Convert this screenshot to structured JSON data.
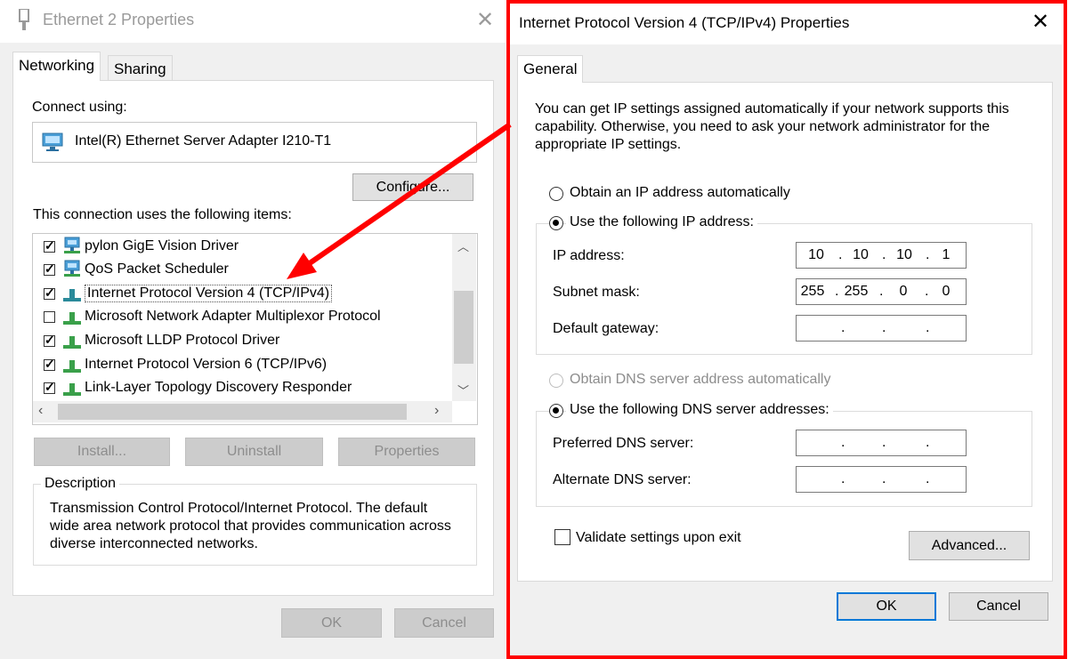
{
  "left_dialog": {
    "title": "Ethernet 2 Properties",
    "tabs": [
      "Networking",
      "Sharing"
    ],
    "connect_using_label": "Connect using:",
    "adapter_name": "Intel(R) Ethernet Server Adapter I210-T1",
    "configure_button": "Configure...",
    "items_label": "This connection uses the following items:",
    "items": [
      {
        "label": "pylon GigE Vision Driver",
        "checked": true
      },
      {
        "label": "QoS Packet Scheduler",
        "checked": true
      },
      {
        "label": "Internet Protocol Version 4 (TCP/IPv4)",
        "checked": true,
        "selected": true
      },
      {
        "label": "Microsoft Network Adapter Multiplexor Protocol",
        "checked": false
      },
      {
        "label": "Microsoft LLDP Protocol Driver",
        "checked": true
      },
      {
        "label": "Internet Protocol Version 6 (TCP/IPv6)",
        "checked": true
      },
      {
        "label": "Link-Layer Topology Discovery Responder",
        "checked": true
      }
    ],
    "install_button": "Install...",
    "uninstall_button": "Uninstall",
    "properties_button": "Properties",
    "description_label": "Description",
    "description_text": "Transmission Control Protocol/Internet Protocol. The default wide area network protocol that provides communication across diverse interconnected networks.",
    "ok_button": "OK",
    "cancel_button": "Cancel"
  },
  "right_dialog": {
    "title": "Internet Protocol Version 4 (TCP/IPv4) Properties",
    "tab": "General",
    "intro_text": "You can get IP settings assigned automatically if your network supports this capability. Otherwise, you need to ask your network administrator for the appropriate IP settings.",
    "auto_ip_label": "Obtain an IP address automatically",
    "manual_ip_label": "Use the following IP address:",
    "ip_address_label": "IP address:",
    "ip_address": [
      "10",
      "10",
      "10",
      "1"
    ],
    "subnet_label": "Subnet mask:",
    "subnet_mask": [
      "255",
      "255",
      "0",
      "0"
    ],
    "gateway_label": "Default gateway:",
    "gateway": [
      "",
      "",
      "",
      ""
    ],
    "auto_dns_label": "Obtain DNS server address automatically",
    "manual_dns_label": "Use the following DNS server addresses:",
    "preferred_dns_label": "Preferred DNS server:",
    "preferred_dns": [
      "",
      "",
      "",
      ""
    ],
    "alternate_dns_label": "Alternate DNS server:",
    "alternate_dns": [
      "",
      "",
      "",
      ""
    ],
    "validate_label": "Validate settings upon exit",
    "advanced_button": "Advanced...",
    "ok_button": "OK",
    "cancel_button": "Cancel"
  },
  "colors": {
    "highlight_frame": "#ff0000",
    "arrow": "#ff0000",
    "default_button_border": "#0078d7"
  }
}
